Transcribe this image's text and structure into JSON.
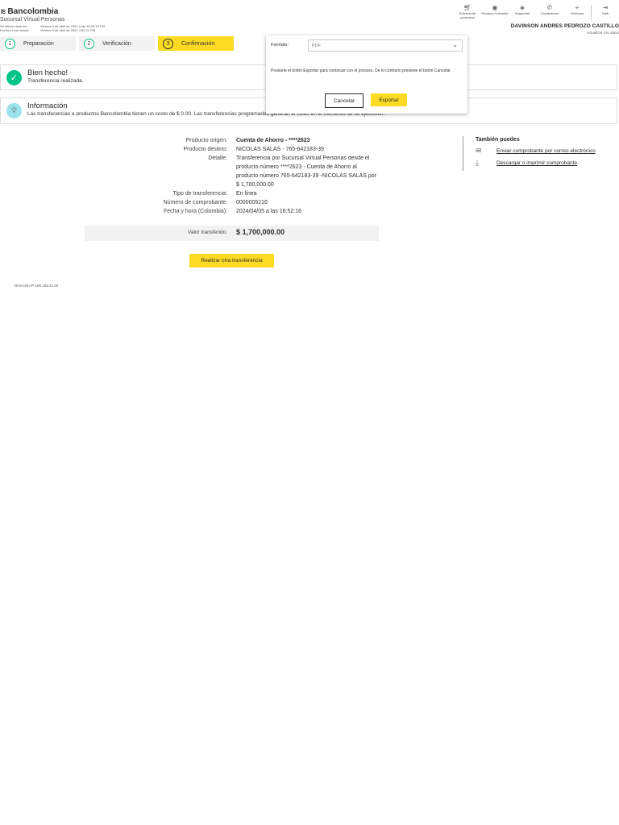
{
  "brand": {
    "name": "Bancolombia",
    "subtitle": "Sucursal Virtual Personas"
  },
  "last_visit": {
    "label": "Su última visita fue:",
    "value": "Viernes 5 de abril de 2024 a las 16:33:10 PM",
    "now_label": "Fecha y hora actual:",
    "now_value": "Viernes 5 de abril de 2024 4:52:21 PM"
  },
  "topnav": [
    {
      "label": "Solicitud de productos",
      "icon": "cart-icon"
    },
    {
      "label": "Rumbos Colombia",
      "icon": "location-pin-icon"
    },
    {
      "label": "Seguridad",
      "icon": "shield-icon"
    },
    {
      "label": "Contáctenos",
      "icon": "phone-icon"
    },
    {
      "label": "Visítenos",
      "icon": "map-pin-icon"
    },
    {
      "label": "Salir",
      "icon": "logout-icon"
    }
  ],
  "user": {
    "name": "DAVINSON ANDRES PEDROZO CASTILLO",
    "update_link": "Actualizar mis datos"
  },
  "steps": [
    {
      "num": "1",
      "label": "Preparación",
      "active": false
    },
    {
      "num": "2",
      "label": "Verificación",
      "active": false
    },
    {
      "num": "3",
      "label": "Confirmación",
      "active": true
    }
  ],
  "success": {
    "title": "Bien hecho!",
    "text": "Transferencia realizada."
  },
  "info": {
    "title": "Información",
    "text": "Las transferencias a productos Bancolombia tienen un costo de $ 0.00. Las transferencias programadas generan el costo en el momento de su ejecución."
  },
  "modal": {
    "format_label": "Formato:",
    "format_value": "PDF",
    "message": "Presione el botón Exportar para continuar con el proceso. De lo contrario presione el botón Cancelar.",
    "cancel": "Cancelar",
    "export": "Exportar"
  },
  "details": {
    "labels": [
      "Producto origen:",
      "Producto destino:",
      "Detalle:",
      "",
      "",
      "",
      "Tipo de transferencia:",
      "Número de comprobante:",
      "Fecha y hora (Colombia):"
    ],
    "origin": "Cuenta de Ahorro - ****2623",
    "destination": "NICOLAS SALAS - 765-642183-39",
    "detail": "Transferencia por Sucursal Virtual Personas desde el producto número ****2623 - Cuenta de Ahorro al producto número 765-642183-39 -NICOLAS SALAS por $ 1,700,000.00",
    "type": "En línea",
    "receipt_number": "0000005216",
    "datetime": "2024/04/05 a las 16:52:16"
  },
  "total": {
    "label": "Valor transferido:",
    "value": "$ 1,700,000.00"
  },
  "other_transfer_button": "Realizar otra transferencia",
  "sidebar": {
    "title": "También puedes",
    "links": [
      {
        "label": "Enviar comprobante por correo electrónico",
        "icon": "envelope-icon"
      },
      {
        "label": "Descargar o imprimir comprobante",
        "icon": "download-icon"
      }
    ]
  },
  "ip": "Dirección IP:186.169.42.45"
}
